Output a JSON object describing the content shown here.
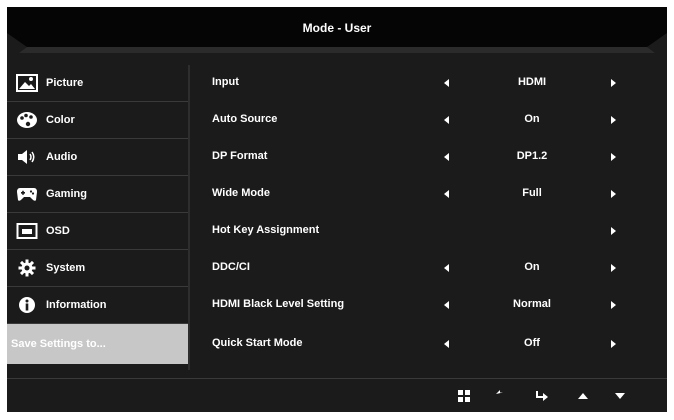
{
  "header": {
    "title": "Mode - User"
  },
  "sidebar": {
    "items": [
      {
        "label": "Picture",
        "icon": "picture-icon"
      },
      {
        "label": "Color",
        "icon": "palette-icon"
      },
      {
        "label": "Audio",
        "icon": "speaker-icon"
      },
      {
        "label": "Gaming",
        "icon": "gamepad-icon"
      },
      {
        "label": "OSD",
        "icon": "osd-icon"
      },
      {
        "label": "System",
        "icon": "gear-icon"
      },
      {
        "label": "Information",
        "icon": "info-icon"
      },
      {
        "label": "Save Settings to..."
      }
    ],
    "selected": "Save Settings to..."
  },
  "settings": [
    {
      "name": "Input",
      "value": "HDMI"
    },
    {
      "name": "Auto Source",
      "value": "On"
    },
    {
      "name": "DP Format",
      "value": "DP1.2"
    },
    {
      "name": "Wide Mode",
      "value": "Full"
    },
    {
      "name": "Hot Key Assignment",
      "value": ""
    },
    {
      "name": "DDC/CI",
      "value": "On"
    },
    {
      "name": "HDMI Black Level Setting",
      "value": "Normal"
    },
    {
      "name": "Quick Start Mode",
      "value": "Off"
    }
  ],
  "footer": {
    "icons": [
      "menu-grid-icon",
      "back-icon",
      "enter-icon",
      "up-arrow-icon",
      "down-arrow-icon"
    ]
  },
  "colors": {
    "background": "#1b1b1b",
    "selected": "#c7c7c7",
    "text": "#ffffff"
  }
}
